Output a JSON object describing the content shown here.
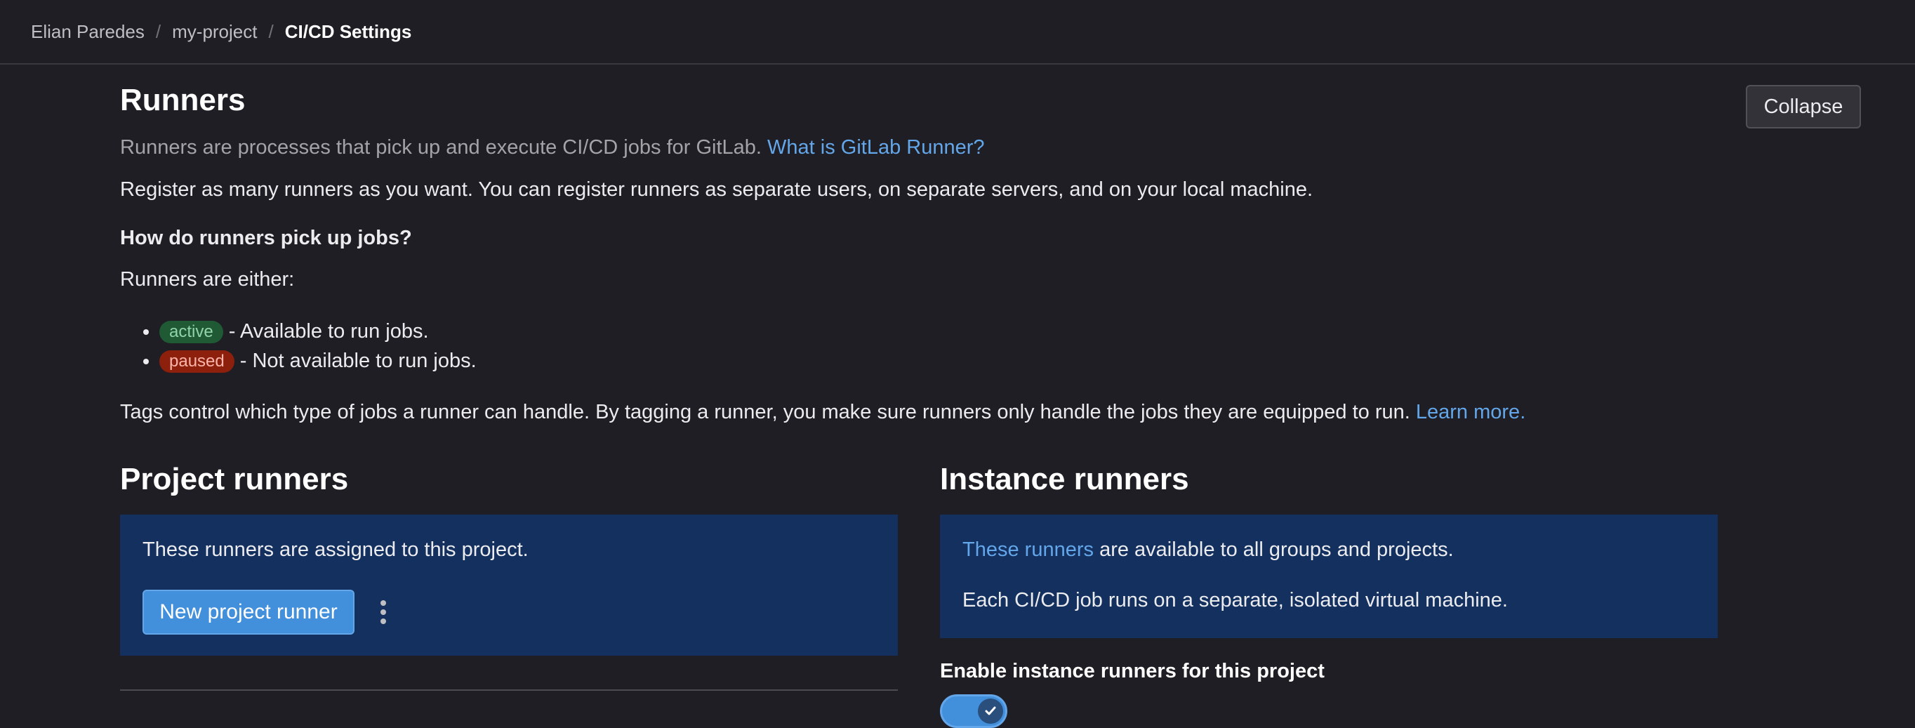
{
  "breadcrumb": {
    "items": [
      "Elian Paredes",
      "my-project"
    ],
    "current": "CI/CD Settings",
    "separator": "/"
  },
  "runners": {
    "title": "Runners",
    "collapse_label": "Collapse",
    "description": "Runners are processes that pick up and execute CI/CD jobs for GitLab.",
    "what_is_link": "What is GitLab Runner?",
    "register_text": "Register as many runners as you want. You can register runners as separate users, on separate servers, and on your local machine.",
    "how_heading": "How do runners pick up jobs?",
    "either_text": "Runners are either:",
    "states": [
      {
        "badge": "active",
        "text": "- Available to run jobs."
      },
      {
        "badge": "paused",
        "text": "- Not available to run jobs."
      }
    ],
    "tags_text": "Tags control which type of jobs a runner can handle. By tagging a runner, you make sure runners only handle the jobs they are equipped to run.",
    "learn_more": "Learn more."
  },
  "project_runners": {
    "title": "Project runners",
    "assigned_text": "These runners are assigned to this project.",
    "new_button": "New project runner"
  },
  "instance_runners": {
    "title": "Instance runners",
    "these_runners_link": "These runners",
    "available_text": "are available to all groups and projects.",
    "isolated_text": "Each CI/CD job runs on a separate, isolated virtual machine.",
    "enable_label": "Enable instance runners for this project",
    "enabled": true
  },
  "colors": {
    "background": "#1f1e24",
    "link": "#63a6e9",
    "panel": "#13305f",
    "primary_button": "#428fdc",
    "badge_active": "#1f5a35",
    "badge_paused": "#8d1f0d"
  }
}
